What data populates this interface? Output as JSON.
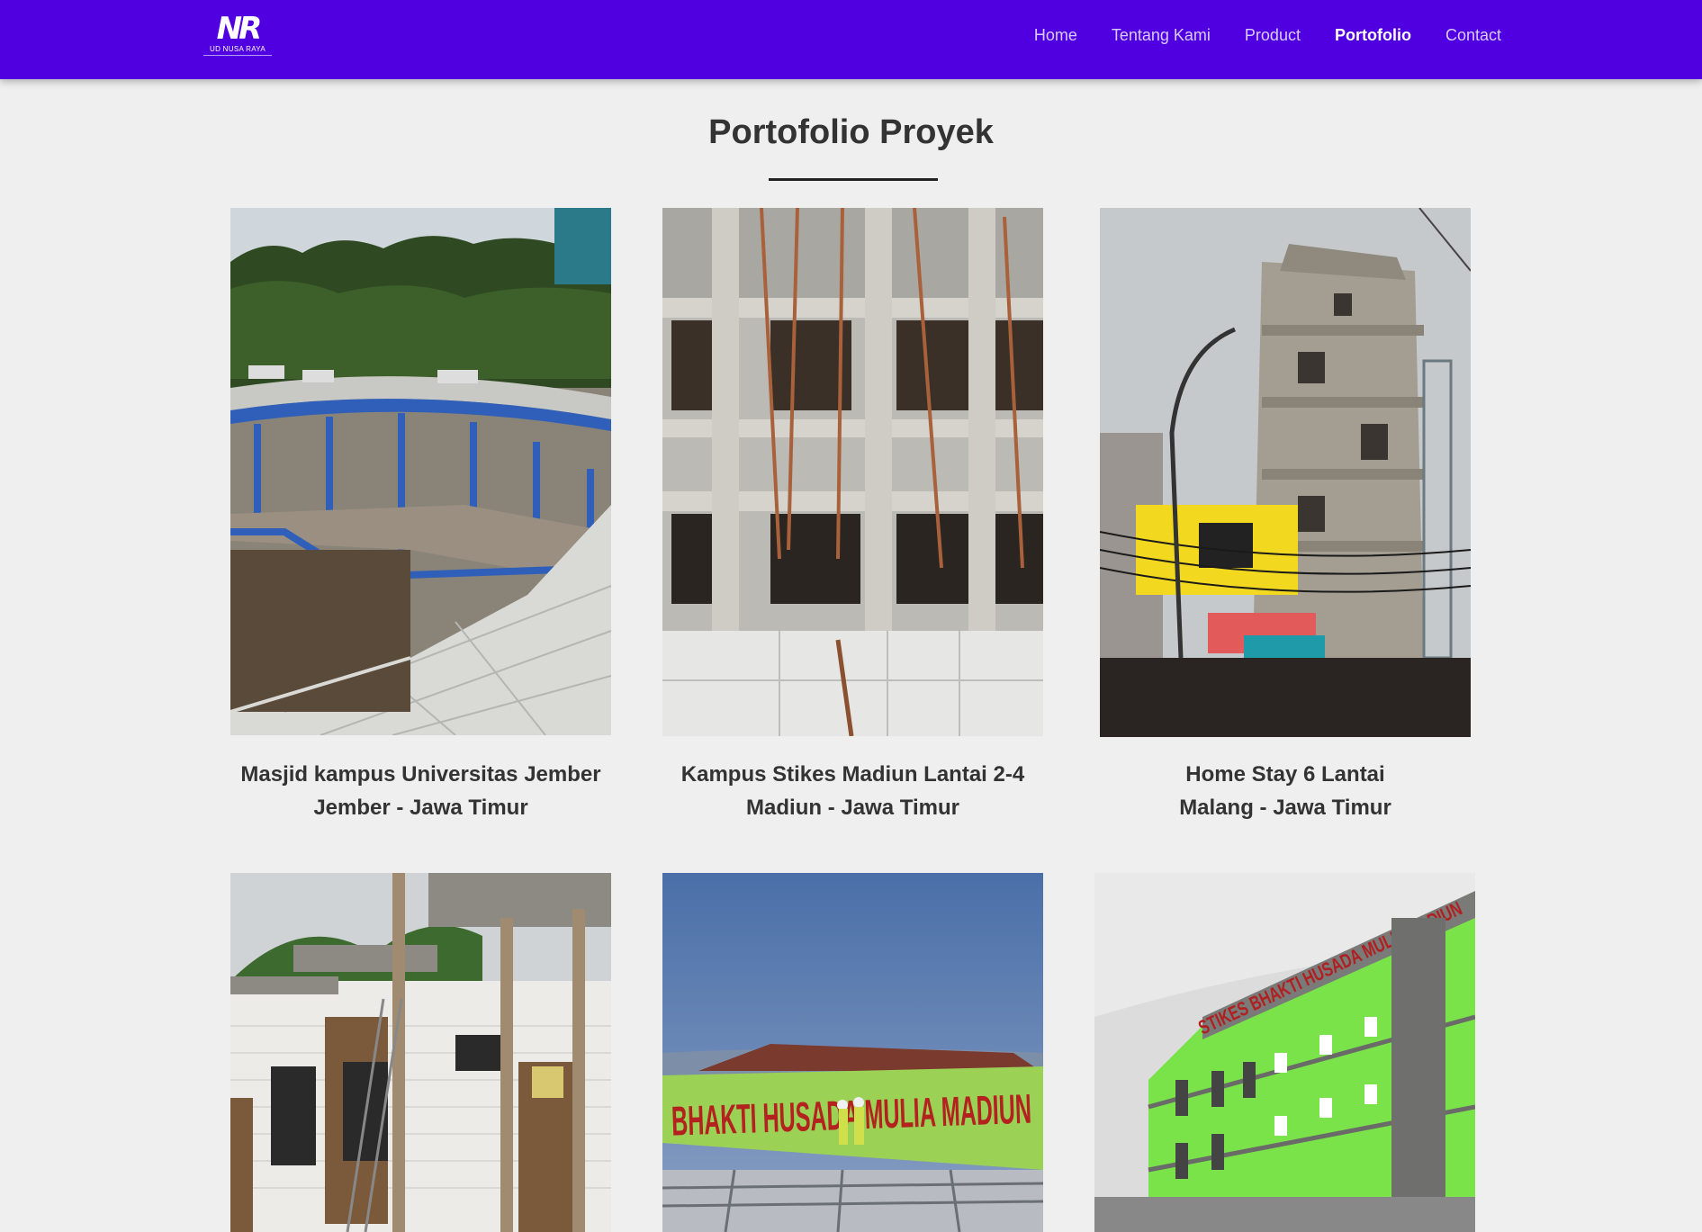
{
  "navbar": {
    "logo_text": "UD NUSA RAYA",
    "logo_mark": "NR",
    "items": [
      {
        "label": "Home",
        "active": false
      },
      {
        "label": "Tentang Kami",
        "active": false
      },
      {
        "label": "Product",
        "active": false
      },
      {
        "label": "Portofolio",
        "active": true
      },
      {
        "label": "Contact",
        "active": false
      }
    ],
    "background_color": "#5000e0"
  },
  "section": {
    "title": "Portofolio Proyek"
  },
  "projects": [
    {
      "name": "Masjid kampus Universitas Jember",
      "location": "Jember - Jawa Timur",
      "image": "mosque-construction-photo"
    },
    {
      "name": "Kampus Stikes Madiun Lantai 2-4",
      "location": "Madiun - Jawa Timur",
      "image": "campus-building-construction-photo"
    },
    {
      "name": "Home Stay 6 Lantai",
      "location": "Malang - Jawa Timur",
      "image": "homestay-building-construction-photo"
    },
    {
      "name": "",
      "location": "",
      "image": "brick-building-construction-photo"
    },
    {
      "name": "",
      "location": "",
      "image": "madiun-rooftop-photo",
      "image_text": "BHAKTI HUSADA MULIA MADIUN"
    },
    {
      "name": "",
      "location": "",
      "image": "green-building-photo",
      "image_text": "STIKES BHAKTI HUSADA MULIA MADIUN"
    }
  ]
}
